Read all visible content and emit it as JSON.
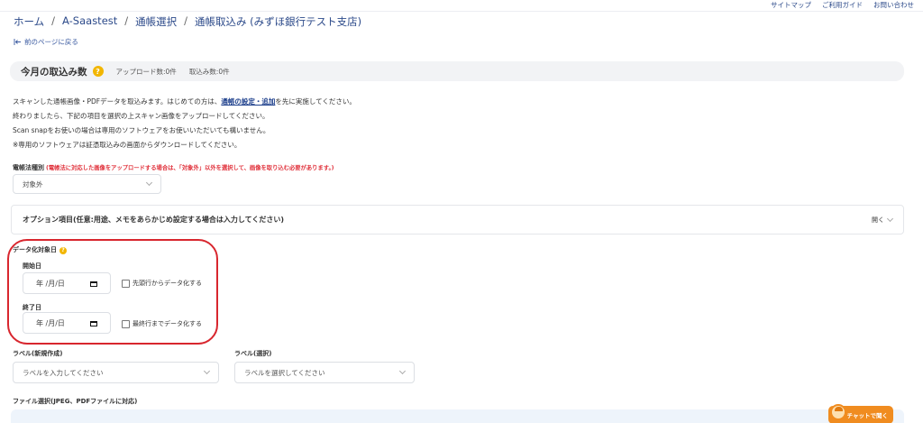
{
  "top_nav": {
    "sitemap": "サイトマップ",
    "guide": "ご利用ガイド",
    "contact": "お問い合わせ"
  },
  "breadcrumb": {
    "home": "ホーム",
    "tenant": "A-Saastest",
    "select": "通帳選択",
    "current": "通帳取込み (みずほ銀行テスト支店)",
    "separator": "/"
  },
  "back_link": "前のページに戻る",
  "summary": {
    "title": "今月の取込み数",
    "help": "?",
    "uploads": "アップロード数:0件",
    "imports": "取込み数:0件"
  },
  "description": {
    "line1_prefix": "スキャンした通帳画像・PDFデータを取込みます。はじめての方は、",
    "line1_link": "通帳の設定・追加",
    "line1_suffix": "を先に実施してください。",
    "line2": "終わりましたら、下記の項目を選択の上スキャン画像をアップロードしてください。",
    "line3": "Scan snapをお使いの場合は専用のソフトウェアをお使いいただいても構いません。",
    "line4": "※専用のソフトウェアは証憑取込みの画面からダウンロードしてください。"
  },
  "denchoho": {
    "label": "電帳法種別",
    "note": "(電帳法に対応した画像をアップロードする場合は、「対象外」以外を選択して、画像を取り込む必要があります。)",
    "value": "対象外"
  },
  "option_panel": {
    "title": "オプション項目(任意:用途、メモをあらかじめ設定する場合は入力してください)",
    "toggle": "開く"
  },
  "data_target": {
    "label": "データ化対象日",
    "help": "?",
    "start_label": "開始日",
    "start_placeholder": "年 /月/日",
    "start_check": "先頭行からデータ化する",
    "end_label": "終了日",
    "end_placeholder": "年 /月/日",
    "end_check": "最終行までデータ化する"
  },
  "label_new": {
    "label": "ラベル(新規作成)",
    "placeholder": "ラベルを入力してください"
  },
  "label_select": {
    "label": "ラベル(選択)",
    "placeholder": "ラベルを選択してください"
  },
  "file_select": {
    "label": "ファイル選択(JPEG、PDFファイルに対応)"
  },
  "chat": {
    "label": "チャットで聞く"
  },
  "colors": {
    "link": "#2c4a8a",
    "badge": "#f2b600",
    "warning": "#e0303a",
    "annotation": "#d8262e",
    "chat": "#f08c20"
  }
}
